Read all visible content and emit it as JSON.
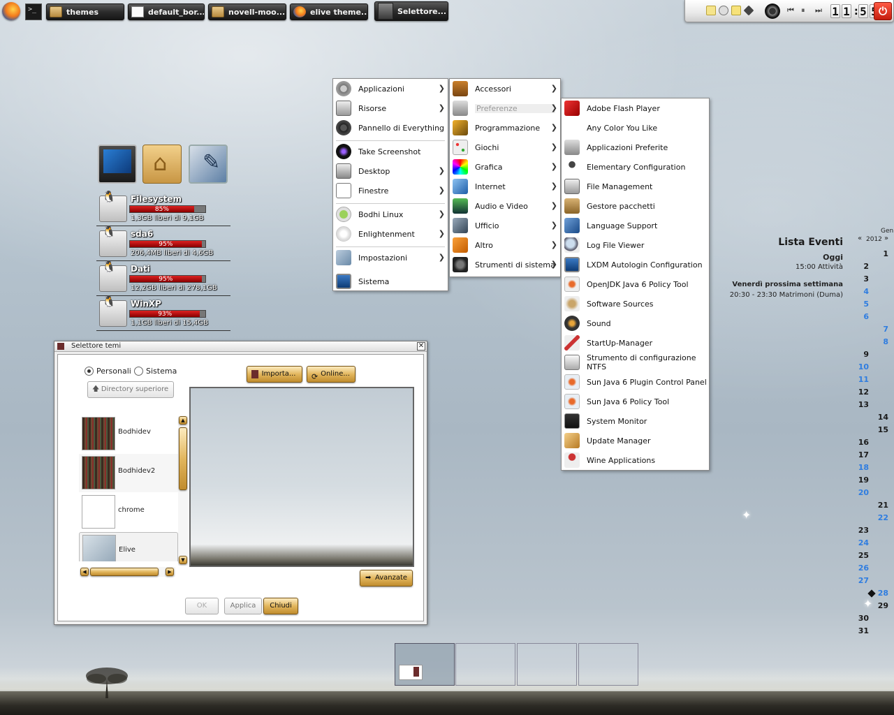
{
  "taskbar": {
    "tasks": [
      {
        "label": "themes",
        "icon": "folder-icon"
      },
      {
        "label": "default_bor...",
        "icon": "document-icon"
      },
      {
        "label": "novell-moo...",
        "icon": "folder-icon"
      },
      {
        "label": "elive theme...",
        "icon": "firefox-icon"
      },
      {
        "label": "Selettore...",
        "icon": "theme-selector-icon"
      }
    ],
    "launchers": [
      "firefox-icon",
      "terminal-icon"
    ],
    "terminal_glyph": ">_"
  },
  "tray": {
    "clock": [
      "1",
      "1",
      ":",
      "5",
      "5"
    ],
    "icons": [
      "note-icon",
      "chat-icon",
      "sticky-note-icon",
      "dropbox-icon",
      "record-icon",
      "prev-icon",
      "pause-icon",
      "next-icon"
    ],
    "power_glyph": "⏻"
  },
  "desktop_icons": [
    "monitor-icon",
    "home-folder-icon",
    "text-editor-icon"
  ],
  "drives": [
    {
      "name": "Filesystem",
      "percent": "85%",
      "fill": 85,
      "free": "1,3GB liberi di 9,1GB"
    },
    {
      "name": "sda6",
      "percent": "95%",
      "fill": 95,
      "free": "206,4MB liberi di 4,6GB"
    },
    {
      "name": "Dati",
      "percent": "95%",
      "fill": 95,
      "free": "12,2GB liberi di 278,1GB"
    },
    {
      "name": "WinXP",
      "percent": "93%",
      "fill": 93,
      "free": "1,1GB liberi di 15,4GB"
    }
  ],
  "main_menu": [
    {
      "label": "Applicazioni",
      "arrow": true,
      "icon": "gear-icon"
    },
    {
      "label": "Risorse",
      "arrow": true,
      "icon": "drive-icon"
    },
    {
      "label": "Pannello di Everything",
      "arrow": false,
      "icon": "gear-icon"
    },
    {
      "label": "Take Screenshot",
      "arrow": false,
      "icon": "camera-icon"
    },
    {
      "label": "Desktop",
      "arrow": true,
      "icon": "desktop-icon"
    },
    {
      "label": "Finestre",
      "arrow": true,
      "icon": "window-icon"
    },
    {
      "label": "Bodhi Linux",
      "arrow": true,
      "icon": "bodhi-icon"
    },
    {
      "label": "Enlightenment",
      "arrow": true,
      "icon": "enlightenment-icon"
    },
    {
      "label": "Impostazioni",
      "arrow": true,
      "icon": "tools-icon"
    },
    {
      "label": "Sistema",
      "arrow": false,
      "icon": "computer-icon"
    }
  ],
  "apps_menu": [
    {
      "label": "Accessori",
      "icon": "accessories-icon"
    },
    {
      "label": "Preferenze",
      "icon": "preferences-icon",
      "highlighted": true
    },
    {
      "label": "Programmazione",
      "icon": "programming-icon"
    },
    {
      "label": "Giochi",
      "icon": "games-icon"
    },
    {
      "label": "Grafica",
      "icon": "graphics-icon"
    },
    {
      "label": "Internet",
      "icon": "internet-icon"
    },
    {
      "label": "Audio e Video",
      "icon": "multimedia-icon"
    },
    {
      "label": "Ufficio",
      "icon": "office-icon"
    },
    {
      "label": "Altro",
      "icon": "other-icon"
    },
    {
      "label": "Strumenti di sistema",
      "icon": "system-tools-icon"
    }
  ],
  "pref_menu": [
    {
      "label": "Adobe Flash Player",
      "icon": "flash-icon"
    },
    {
      "label": "Any Color You Like",
      "icon": "color-icon"
    },
    {
      "label": "Applicazioni Preferite",
      "icon": "preferred-apps-icon"
    },
    {
      "label": "Elementary Configuration",
      "icon": "elementary-icon"
    },
    {
      "label": "File Management",
      "icon": "file-management-icon"
    },
    {
      "label": "Gestore pacchetti",
      "icon": "package-icon"
    },
    {
      "label": "Language Support",
      "icon": "language-icon"
    },
    {
      "label": "Log File Viewer",
      "icon": "log-viewer-icon"
    },
    {
      "label": "LXDM Autologin Configuration",
      "icon": "monitor-icon"
    },
    {
      "label": "OpenJDK Java 6 Policy Tool",
      "icon": "java-icon"
    },
    {
      "label": "Software Sources",
      "icon": "software-sources-icon"
    },
    {
      "label": "Sound",
      "icon": "speaker-icon"
    },
    {
      "label": "StartUp-Manager",
      "icon": "startup-icon"
    },
    {
      "label": "Strumento di configurazione NTFS",
      "icon": "ntfs-icon"
    },
    {
      "label": "Sun Java 6 Plugin Control Panel",
      "icon": "java-icon"
    },
    {
      "label": "Sun Java 6 Policy Tool",
      "icon": "java-icon"
    },
    {
      "label": "System Monitor",
      "icon": "system-monitor-icon"
    },
    {
      "label": "Update Manager",
      "icon": "update-icon"
    },
    {
      "label": "Wine Applications",
      "icon": "wine-icon"
    }
  ],
  "dialog": {
    "title": "Selettore temi",
    "close": "✕",
    "radio_personal": "Personali",
    "radio_system": "Sistema",
    "dir_up": "Directory superiore",
    "import": "Importa...",
    "online": "Online...",
    "advanced": "Avanzate",
    "ok": "OK",
    "apply": "Applica",
    "close_btn": "Chiudi",
    "themes": [
      {
        "name": "Bodhidev",
        "selected": false
      },
      {
        "name": "Bodhidev2",
        "selected": false
      },
      {
        "name": "chrome",
        "selected": false
      },
      {
        "name": "Elive",
        "selected": true
      }
    ]
  },
  "events": {
    "title": "Lista Eventi",
    "today": "Oggi",
    "today_event": "15:00 Attività",
    "next_week": "Venerdì prossima settimana",
    "next_event": "20:30 - 23:30 Matrimoni (Duma)"
  },
  "calendar": {
    "month": "Gen",
    "year": "2012",
    "prev": "«",
    "next": "»",
    "days": [
      {
        "d": "1",
        "col": 1,
        "we": false
      },
      {
        "d": "2",
        "col": 0,
        "we": false
      },
      {
        "d": "3",
        "col": 0,
        "we": false
      },
      {
        "d": "4",
        "col": 0,
        "we": true
      },
      {
        "d": "5",
        "col": 0,
        "we": true
      },
      {
        "d": "6",
        "col": 0,
        "we": true
      },
      {
        "d": "7",
        "col": 1,
        "we": true
      },
      {
        "d": "8",
        "col": 1,
        "we": true
      },
      {
        "d": "9",
        "col": 0,
        "we": false
      },
      {
        "d": "10",
        "col": 0,
        "we": true
      },
      {
        "d": "11",
        "col": 0,
        "we": true
      },
      {
        "d": "12",
        "col": 0,
        "we": false
      },
      {
        "d": "13",
        "col": 0,
        "we": false
      },
      {
        "d": "14",
        "col": 1,
        "we": false
      },
      {
        "d": "15",
        "col": 1,
        "we": false
      },
      {
        "d": "16",
        "col": 0,
        "we": false
      },
      {
        "d": "17",
        "col": 0,
        "we": false
      },
      {
        "d": "18",
        "col": 0,
        "we": true
      },
      {
        "d": "19",
        "col": 0,
        "we": false
      },
      {
        "d": "20",
        "col": 0,
        "we": true
      },
      {
        "d": "21",
        "col": 1,
        "we": false
      },
      {
        "d": "22",
        "col": 1,
        "we": true
      },
      {
        "d": "23",
        "col": 0,
        "we": false
      },
      {
        "d": "24",
        "col": 0,
        "we": true
      },
      {
        "d": "25",
        "col": 0,
        "we": false
      },
      {
        "d": "26",
        "col": 0,
        "we": true
      },
      {
        "d": "27",
        "col": 0,
        "we": true
      },
      {
        "d": "28",
        "col": 1,
        "we": true
      },
      {
        "d": "29",
        "col": 1,
        "we": false
      },
      {
        "d": "30",
        "col": 0,
        "we": false
      },
      {
        "d": "31",
        "col": 0,
        "we": false
      }
    ]
  },
  "pager": {
    "desks": 4,
    "active": 0
  },
  "colors": {
    "accent_gold": "#e2b65d",
    "calendar_weekend": "#2f7de0",
    "usage_bar": "#cc2222"
  }
}
